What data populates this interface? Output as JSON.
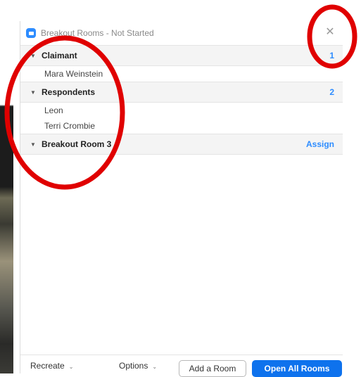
{
  "window": {
    "title": "Breakout Rooms - Not Started"
  },
  "icons": {
    "app": "zoom-app-icon",
    "close": "close-icon",
    "caret": "caret-down-icon",
    "chevron": "chevron-down-icon"
  },
  "colors": {
    "accent": "#2d8cff",
    "primary_button": "#0e72ed",
    "annotation": "#e00000"
  },
  "glyphs": {
    "caret": "▼",
    "chevron": "⌄",
    "close": "✕"
  },
  "rooms": [
    {
      "name": "Claimant",
      "count": "1",
      "members": [
        "Mara Weinstein"
      ]
    },
    {
      "name": "Respondents",
      "count": "2",
      "members": [
        "Leon",
        "Terri Crombie"
      ]
    },
    {
      "name": "Breakout Room 3",
      "action": "Assign",
      "members": []
    }
  ],
  "footer": {
    "recreate_label": "Recreate",
    "options_label": "Options",
    "add_room_label": "Add a Room",
    "open_all_label": "Open All Rooms"
  }
}
